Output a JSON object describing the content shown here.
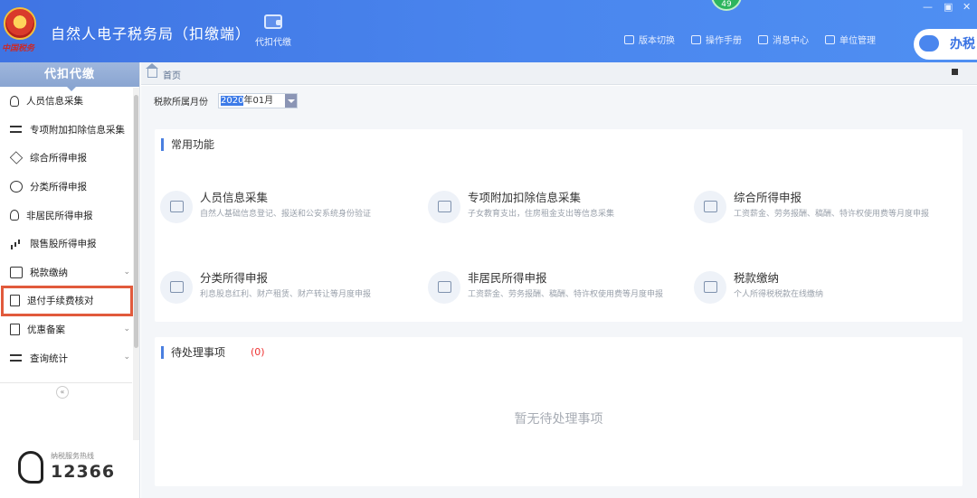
{
  "header": {
    "title": "自然人电子税务局（扣缴端）",
    "emblem_text": "中国税务",
    "daikou_label": "代扣代缴",
    "badge": "49",
    "window_controls": [
      "—",
      "▣",
      "✕"
    ],
    "links": [
      {
        "label": "版本切换",
        "icon": "switch-icon"
      },
      {
        "label": "操作手册",
        "icon": "manual-icon"
      },
      {
        "label": "消息中心",
        "icon": "mail-icon"
      },
      {
        "label": "单位管理",
        "icon": "building-icon"
      }
    ],
    "banshui_label": "办税"
  },
  "sidebar": {
    "title": "代扣代缴",
    "items": [
      {
        "label": "人员信息采集",
        "icon": "person-icon",
        "expandable": false
      },
      {
        "label": "专项附加扣除信息采集",
        "icon": "list-icon",
        "expandable": false
      },
      {
        "label": "综合所得申报",
        "icon": "layers-icon",
        "expandable": false
      },
      {
        "label": "分类所得申报",
        "icon": "pie-icon",
        "expandable": false
      },
      {
        "label": "非居民所得申报",
        "icon": "person-icon",
        "expandable": false
      },
      {
        "label": "限售股所得申报",
        "icon": "chart-icon",
        "expandable": false
      },
      {
        "label": "税款缴纳",
        "icon": "folder-icon",
        "expandable": true
      },
      {
        "label": "退付手续费核对",
        "icon": "doc-icon",
        "expandable": false,
        "highlighted": true
      },
      {
        "label": "优惠备案",
        "icon": "doc-icon",
        "expandable": true
      },
      {
        "label": "查询统计",
        "icon": "search-list-icon",
        "expandable": true
      }
    ],
    "collapse_glyph": "«",
    "hotline_label": "纳税服务热线",
    "hotline_number": "12366"
  },
  "tabbar": {
    "home_label": "首页"
  },
  "main": {
    "period_label": "税款所属月份",
    "period_year": "2020",
    "period_rest": "年01月",
    "common_title": "常用功能",
    "functions": [
      {
        "title": "人员信息采集",
        "desc": "自然人基础信息登记、报送和公安系统身份验证"
      },
      {
        "title": "专项附加扣除信息采集",
        "desc": "子女教育支出，住房租金支出等信息采集"
      },
      {
        "title": "综合所得申报",
        "desc": "工资薪金、劳务报酬、稿酬、特许权使用费等月度申报"
      },
      {
        "title": "分类所得申报",
        "desc": "利息股息红利、财产租赁、财产转让等月度申报"
      },
      {
        "title": "非居民所得申报",
        "desc": "工资薪金、劳务报酬、稿酬、特许权使用费等月度申报"
      },
      {
        "title": "税款缴纳",
        "desc": "个人所得税税款在线缴纳"
      }
    ],
    "pending_title": "待处理事项",
    "pending_count": "(0)",
    "pending_empty": "暂无待处理事项"
  },
  "colors": {
    "header_blue": "#4a86ee",
    "highlight_red": "#e15a3c",
    "accent": "#4a7fe0"
  }
}
